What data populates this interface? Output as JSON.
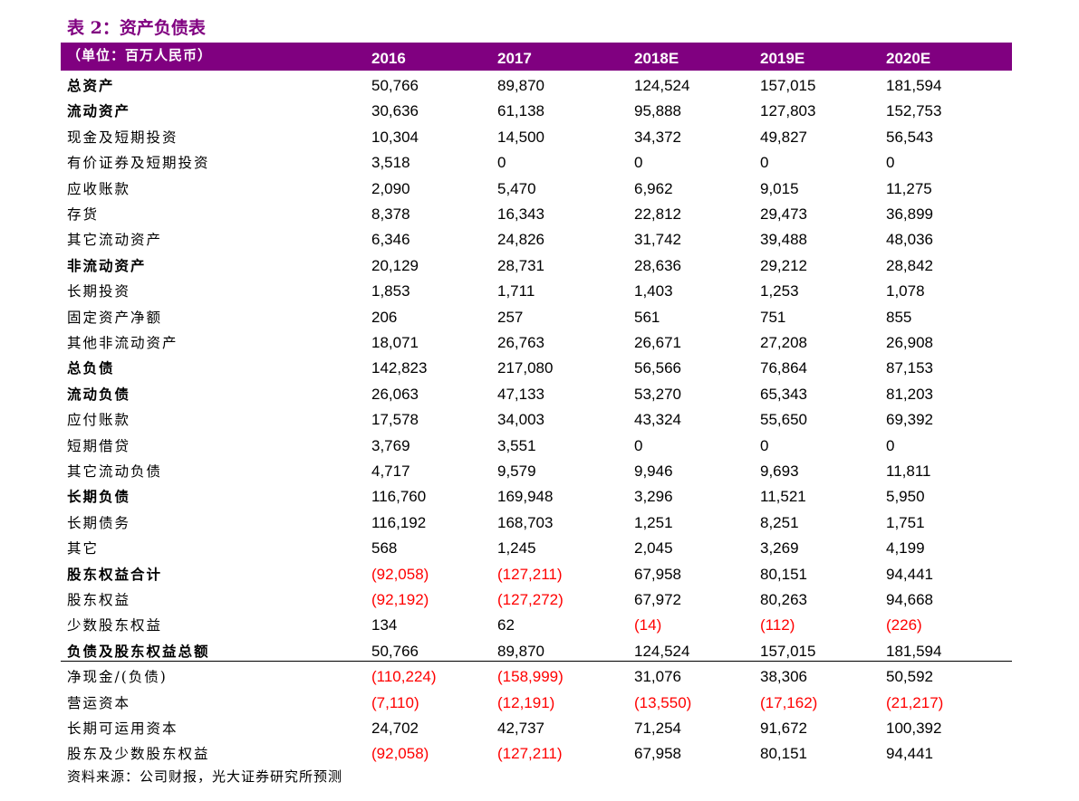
{
  "title": "表 2：资产负债表",
  "header": {
    "unit_label": "（单位：百万人民币）",
    "years": [
      "2016",
      "2017",
      "2018E",
      "2019E",
      "2020E"
    ]
  },
  "rows": [
    {
      "label": "总资产",
      "bold": true,
      "values": [
        "50,766",
        "89,870",
        "124,524",
        "157,015",
        "181,594"
      ]
    },
    {
      "label": "流动资产",
      "bold": true,
      "values": [
        "30,636",
        "61,138",
        "95,888",
        "127,803",
        "152,753"
      ]
    },
    {
      "label": "现金及短期投资",
      "bold": false,
      "values": [
        "10,304",
        "14,500",
        "34,372",
        "49,827",
        "56,543"
      ]
    },
    {
      "label": "有价证券及短期投资",
      "bold": false,
      "values": [
        "3,518",
        "0",
        "0",
        "0",
        "0"
      ]
    },
    {
      "label": "应收账款",
      "bold": false,
      "values": [
        "2,090",
        "5,470",
        "6,962",
        "9,015",
        "11,275"
      ]
    },
    {
      "label": "存货",
      "bold": false,
      "values": [
        "8,378",
        "16,343",
        "22,812",
        "29,473",
        "36,899"
      ]
    },
    {
      "label": "其它流动资产",
      "bold": false,
      "values": [
        "6,346",
        "24,826",
        "31,742",
        "39,488",
        "48,036"
      ]
    },
    {
      "label": "非流动资产",
      "bold": true,
      "values": [
        "20,129",
        "28,731",
        "28,636",
        "29,212",
        "28,842"
      ]
    },
    {
      "label": "长期投资",
      "bold": false,
      "values": [
        "1,853",
        "1,711",
        "1,403",
        "1,253",
        "1,078"
      ]
    },
    {
      "label": "固定资产净额",
      "bold": false,
      "values": [
        "206",
        "257",
        "561",
        "751",
        "855"
      ]
    },
    {
      "label": "其他非流动资产",
      "bold": false,
      "values": [
        "18,071",
        "26,763",
        "26,671",
        "27,208",
        "26,908"
      ]
    },
    {
      "label": "总负债",
      "bold": true,
      "values": [
        "142,823",
        "217,080",
        "56,566",
        "76,864",
        "87,153"
      ]
    },
    {
      "label": "流动负债",
      "bold": true,
      "values": [
        "26,063",
        "47,133",
        "53,270",
        "65,343",
        "81,203"
      ]
    },
    {
      "label": "应付账款",
      "bold": false,
      "values": [
        "17,578",
        "34,003",
        "43,324",
        "55,650",
        "69,392"
      ]
    },
    {
      "label": "短期借贷",
      "bold": false,
      "values": [
        "3,769",
        "3,551",
        "0",
        "0",
        "0"
      ]
    },
    {
      "label": "其它流动负债",
      "bold": false,
      "values": [
        "4,717",
        "9,579",
        "9,946",
        "9,693",
        "11,811"
      ]
    },
    {
      "label": "长期负债",
      "bold": true,
      "values": [
        "116,760",
        "169,948",
        "3,296",
        "11,521",
        "5,950"
      ]
    },
    {
      "label": "长期债务",
      "bold": false,
      "values": [
        "116,192",
        "168,703",
        "1,251",
        "8,251",
        "1,751"
      ]
    },
    {
      "label": "其它",
      "bold": false,
      "values": [
        "568",
        "1,245",
        "2,045",
        "3,269",
        "4,199"
      ]
    },
    {
      "label": "股东权益合计",
      "bold": true,
      "values": [
        "(92,058)",
        "(127,211)",
        "67,958",
        "80,151",
        "94,441"
      ]
    },
    {
      "label": "股东权益",
      "bold": false,
      "values": [
        "(92,192)",
        "(127,272)",
        "67,972",
        "80,263",
        "94,668"
      ]
    },
    {
      "label": "少数股东权益",
      "bold": false,
      "values": [
        "134",
        "62",
        "(14)",
        "(112)",
        "(226)"
      ]
    },
    {
      "label": "负债及股东权益总额",
      "bold": true,
      "values": [
        "50,766",
        "89,870",
        "124,524",
        "157,015",
        "181,594"
      ]
    },
    {
      "label": "净现金/(负债)",
      "bold": false,
      "values": [
        "(110,224)",
        "(158,999)",
        "31,076",
        "38,306",
        "50,592"
      ]
    },
    {
      "label": "营运资本",
      "bold": false,
      "values": [
        "(7,110)",
        "(12,191)",
        "(13,550)",
        "(17,162)",
        "(21,217)"
      ]
    },
    {
      "label": "长期可运用资本",
      "bold": false,
      "values": [
        "24,702",
        "42,737",
        "71,254",
        "91,672",
        "100,392"
      ]
    },
    {
      "label": "股东及少数股东权益",
      "bold": false,
      "values": [
        "(92,058)",
        "(127,211)",
        "67,958",
        "80,151",
        "94,441"
      ]
    }
  ],
  "source": "资料来源：公司财报，光大证券研究所预测",
  "colors": {
    "header_bg": "#800080",
    "title": "#800080",
    "negative": "#ff0000"
  }
}
